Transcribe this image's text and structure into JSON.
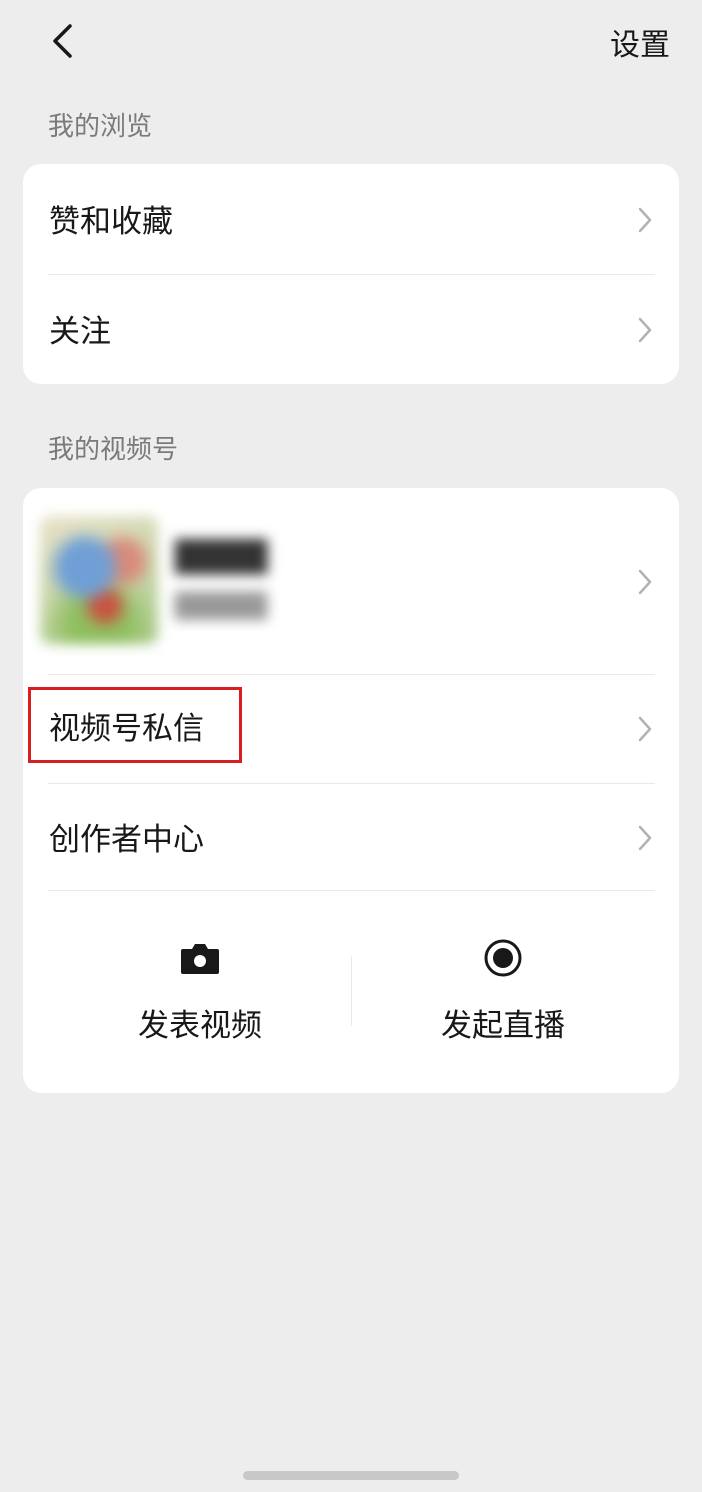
{
  "header": {
    "settings_label": "设置"
  },
  "browse": {
    "section_title": "我的浏览",
    "items": [
      {
        "label": "赞和收藏"
      },
      {
        "label": "关注"
      }
    ]
  },
  "channels": {
    "section_title": "我的视频号",
    "items": [
      {
        "label": "视频号私信"
      },
      {
        "label": "创作者中心"
      }
    ],
    "actions": [
      {
        "label": "发表视频",
        "icon": "camera-icon"
      },
      {
        "label": "发起直播",
        "icon": "live-record-icon"
      }
    ]
  },
  "colors": {
    "background": "#ededed",
    "card": "#ffffff",
    "highlight": "#d81e1e"
  }
}
